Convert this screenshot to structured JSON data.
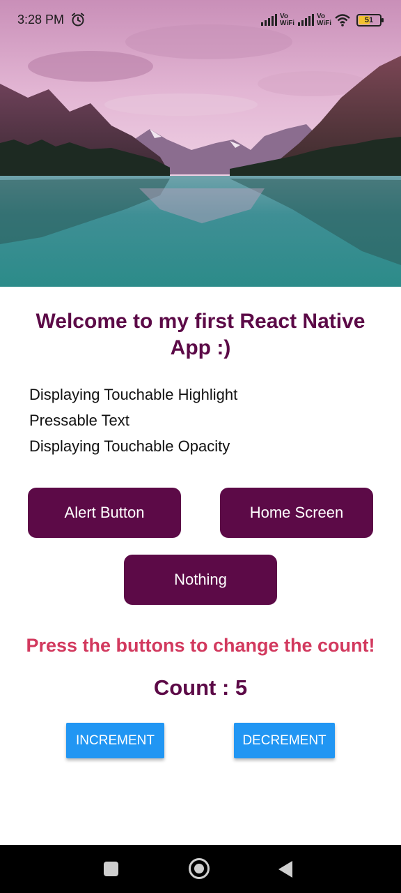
{
  "status_bar": {
    "time": "3:28 PM",
    "alarm_icon": "alarm-clock-icon",
    "network_label_1": "Vo\nWiFi",
    "network_label_2": "Vo\nWiFi",
    "battery_level": "51",
    "battery_fraction": 0.51
  },
  "hero": {
    "icon": "mountain-lake-landscape-image"
  },
  "main": {
    "title": "Welcome to my first React Native App :)",
    "lines": [
      "Displaying Touchable Highlight",
      "Pressable Text",
      "Displaying Touchable Opacity"
    ],
    "buttons": {
      "alert": "Alert Button",
      "home": "Home Screen",
      "nothing": "Nothing"
    },
    "prompt": "Press the buttons to change the count!",
    "count_label": "Count : ",
    "count_value": "5",
    "increment": "INCREMENT",
    "decrement": "DECREMENT"
  },
  "colors": {
    "primary": "#5c0a47",
    "prompt": "#d2395e",
    "material_button": "#2196f3",
    "nav_bar": "#000000"
  },
  "nav": {
    "recent_icon": "square-recents-icon",
    "home_icon": "circle-home-icon",
    "back_icon": "triangle-back-icon"
  }
}
